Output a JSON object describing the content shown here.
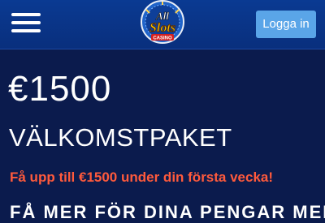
{
  "header": {
    "logo": {
      "line1": "All",
      "line2": "Slots",
      "line3": "CASINO"
    },
    "login_label": "Logga in"
  },
  "main": {
    "amount": "€1500",
    "title": "VÄLKOMSTPAKET",
    "subtitle": "Få upp till €1500 under din första vecka!",
    "partial_heading": "FÅ MER FÖR DINA PENGAR MED"
  },
  "colors": {
    "background": "#0b1b4d",
    "header": "#0a3a92",
    "login_button": "#5aa5e8",
    "accent_red": "#ff5a3c"
  }
}
